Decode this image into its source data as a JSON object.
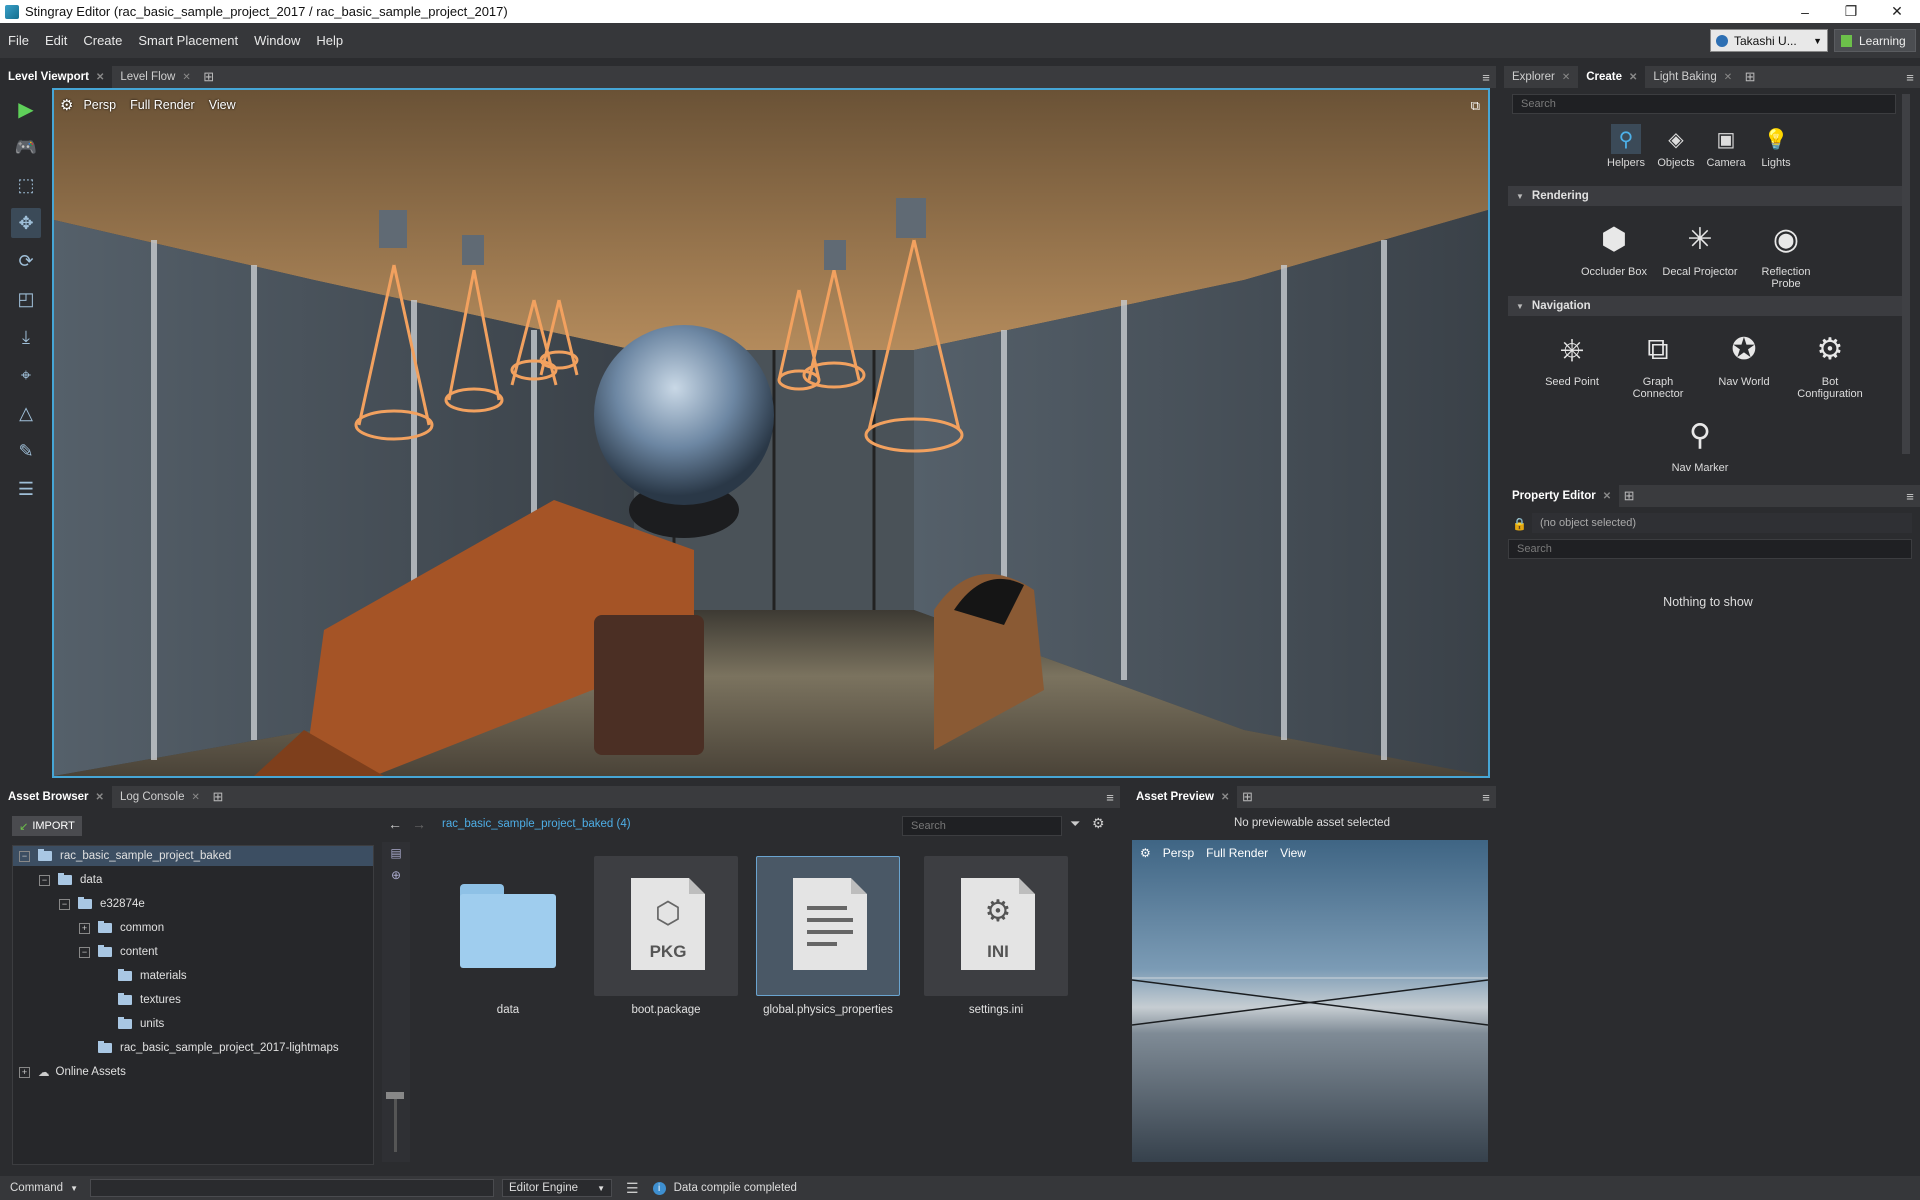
{
  "window": {
    "title": "Stingray Editor (rac_basic_sample_project_2017 / rac_basic_sample_project_2017)",
    "minimize": "–",
    "maximize": "❐",
    "close": "✕"
  },
  "menu": {
    "items": [
      "File",
      "Edit",
      "Create",
      "Smart Placement",
      "Window",
      "Help"
    ],
    "user": "Takashi U...",
    "learning": "Learning"
  },
  "viewport_tabs": [
    {
      "label": "Level Viewport"
    },
    {
      "label": "Level Flow"
    }
  ],
  "viewport": {
    "settings_icon": "gear-icon",
    "persp": "Persp",
    "render": "Full Render",
    "view": "View"
  },
  "explorer": {
    "tabs": [
      "Explorer",
      "Create",
      "Light Baking"
    ],
    "search_placeholder": "Search",
    "categories": [
      {
        "label": "Helpers",
        "icon": "pin-icon"
      },
      {
        "label": "Objects",
        "icon": "cube-icon"
      },
      {
        "label": "Camera",
        "icon": "camera-icon"
      },
      {
        "label": "Lights",
        "icon": "bulb-icon"
      }
    ],
    "sections": [
      {
        "title": "Rendering",
        "items": [
          "Occluder Box",
          "Decal Projector",
          "Reflection Probe"
        ]
      },
      {
        "title": "Navigation",
        "items": [
          "Seed Point",
          "Graph Connector",
          "Nav World",
          "Bot Configuration",
          "Nav Marker"
        ]
      }
    ]
  },
  "property_editor": {
    "title": "Property Editor",
    "selection": "(no object selected)",
    "search_placeholder": "Search",
    "empty": "Nothing to show"
  },
  "asset_tabs": [
    {
      "label": "Asset Browser"
    },
    {
      "label": "Log Console"
    }
  ],
  "asset_browser": {
    "import": "IMPORT",
    "path": "rac_basic_sample_project_baked (4)",
    "search_placeholder": "Search",
    "tree": [
      {
        "label": "rac_basic_sample_project_baked",
        "depth": 0,
        "exp": "⊟"
      },
      {
        "label": "data",
        "depth": 1,
        "exp": "⊟"
      },
      {
        "label": "e32874e",
        "depth": 2,
        "exp": "⊟"
      },
      {
        "label": "common",
        "depth": 3,
        "exp": "⊞"
      },
      {
        "label": "content",
        "depth": 3,
        "exp": "⊟"
      },
      {
        "label": "materials",
        "depth": 4,
        "exp": ""
      },
      {
        "label": "textures",
        "depth": 4,
        "exp": ""
      },
      {
        "label": "units",
        "depth": 4,
        "exp": ""
      },
      {
        "label": "rac_basic_sample_project_2017-lightmaps",
        "depth": 3,
        "exp": ""
      },
      {
        "label": "Online Assets",
        "depth": 0,
        "exp": "⊞"
      }
    ],
    "files": [
      {
        "name": "data",
        "type": "folder"
      },
      {
        "name": "boot.package",
        "type": "PKG"
      },
      {
        "name": "global.physics_properties",
        "type": "doc"
      },
      {
        "name": "settings.ini",
        "type": "INI"
      }
    ]
  },
  "asset_preview": {
    "title": "Asset Preview",
    "message": "No previewable asset selected",
    "persp": "Persp",
    "render": "Full Render",
    "view": "View"
  },
  "status": {
    "command": "Command",
    "engine": "Editor Engine",
    "message": "Data compile completed"
  }
}
